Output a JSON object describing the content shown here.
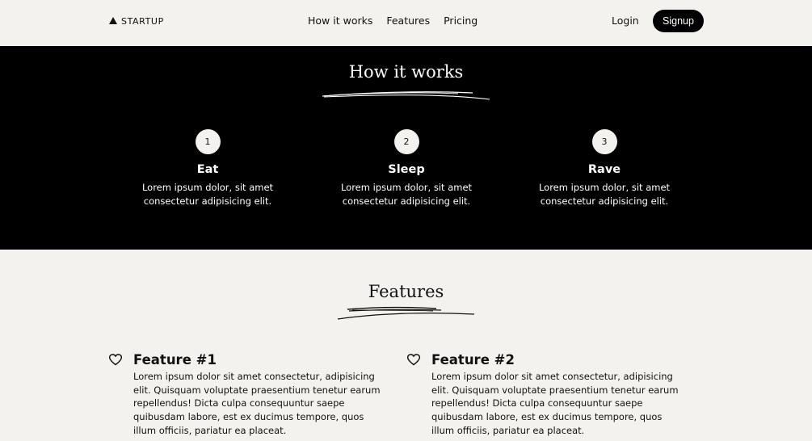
{
  "nav": {
    "brand": "STARTUP",
    "links": [
      "How it works",
      "Features",
      "Pricing"
    ],
    "login": "Login",
    "signup": "Signup"
  },
  "how_it_works": {
    "title": "How it works",
    "steps": [
      {
        "number": "1",
        "title": "Eat",
        "text": "Lorem ipsum dolor, sit amet consectetur adipisicing elit."
      },
      {
        "number": "2",
        "title": "Sleep",
        "text": "Lorem ipsum dolor, sit amet consectetur adipisicing elit."
      },
      {
        "number": "3",
        "title": "Rave",
        "text": "Lorem ipsum dolor, sit amet consectetur adipisicing elit."
      }
    ]
  },
  "features": {
    "title": "Features",
    "items": [
      {
        "title": "Feature #1",
        "text": "Lorem ipsum dolor sit amet consectetur, adipisicing elit. Quisquam voluptate praesentium tenetur earum repellendus! Dicta culpa consequuntur saepe quibusdam labore, est ex ducimus tempore, quos illum officiis, pariatur ea placeat.",
        "icon": "heart-icon"
      },
      {
        "title": "Feature #2",
        "text": "Lorem ipsum dolor sit amet consectetur, adipisicing elit. Quisquam voluptate praesentium tenetur earum repellendus! Dicta culpa consequuntur saepe quibusdam labore, est ex ducimus tempore, quos illum officiis, pariatur ea placeat.",
        "icon": "heart-icon"
      }
    ]
  },
  "colors": {
    "background": "#f4f2ee",
    "dark": "#000000"
  }
}
